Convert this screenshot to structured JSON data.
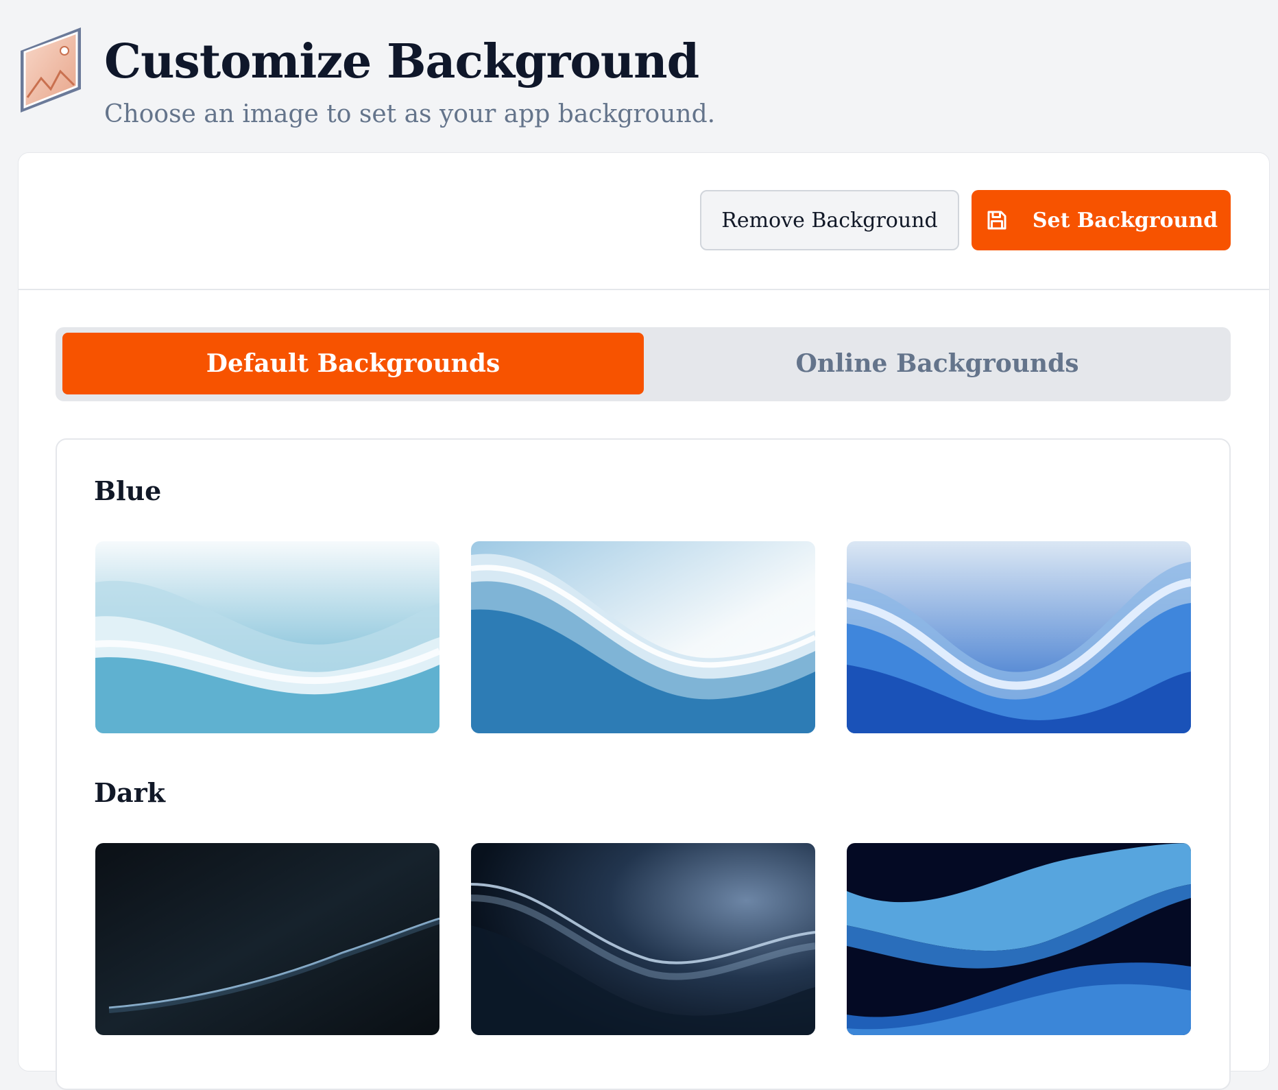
{
  "header": {
    "title": "Customize Background",
    "subtitle": "Choose an image to set as your app background."
  },
  "toolbar": {
    "remove_label": "Remove Background",
    "set_label": "Set Background"
  },
  "tabs": [
    {
      "label": "Default Backgrounds",
      "active": true
    },
    {
      "label": "Online Backgrounds",
      "active": false
    }
  ],
  "gallery": {
    "sections": [
      {
        "title": "Blue"
      },
      {
        "title": "Dark"
      }
    ]
  },
  "colors": {
    "accent": "#f75300",
    "page_bg": "#f3f4f6"
  },
  "icons": {
    "header": "image-frame-icon",
    "set_button": "save-icon"
  }
}
